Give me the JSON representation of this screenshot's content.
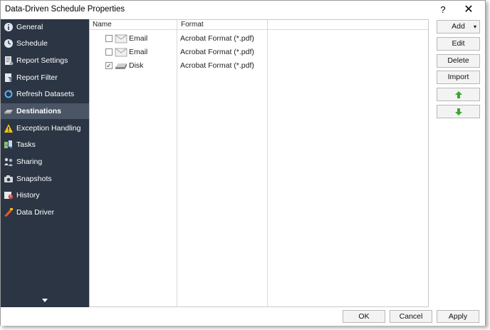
{
  "window": {
    "title": "Data-Driven Schedule Properties",
    "help_label": "?",
    "close_label": "✕"
  },
  "sidebar": {
    "items": [
      {
        "label": "General",
        "icon": "info-icon"
      },
      {
        "label": "Schedule",
        "icon": "clock-icon"
      },
      {
        "label": "Report Settings",
        "icon": "report-settings-icon"
      },
      {
        "label": "Report Filter",
        "icon": "filter-icon"
      },
      {
        "label": "Refresh Datasets",
        "icon": "refresh-icon"
      },
      {
        "label": "Destinations",
        "icon": "destinations-icon",
        "selected": true
      },
      {
        "label": "Exception Handling",
        "icon": "warning-icon"
      },
      {
        "label": "Tasks",
        "icon": "tasks-icon"
      },
      {
        "label": "Sharing",
        "icon": "sharing-icon"
      },
      {
        "label": "Snapshots",
        "icon": "snapshots-icon"
      },
      {
        "label": "History",
        "icon": "history-icon"
      },
      {
        "label": "Data Driver",
        "icon": "data-driver-icon"
      }
    ]
  },
  "list": {
    "columns": [
      "Name",
      "Format"
    ],
    "rows": [
      {
        "checked": false,
        "name": "Email",
        "format": "Acrobat Format (*.pdf)",
        "icon": "email-icon"
      },
      {
        "checked": false,
        "name": "Email",
        "format": "Acrobat Format (*.pdf)",
        "icon": "email-icon"
      },
      {
        "checked": true,
        "name": "Disk",
        "format": "Acrobat Format (*.pdf)",
        "icon": "disk-icon"
      }
    ]
  },
  "actions": {
    "add": "Add",
    "edit": "Edit",
    "delete": "Delete",
    "import": "Import"
  },
  "footer": {
    "ok": "OK",
    "cancel": "Cancel",
    "apply": "Apply"
  },
  "colors": {
    "sidebar_bg": "#2b3544",
    "sidebar_selected": "#4a5566",
    "up_arrow": "#3aa82e",
    "down_arrow": "#3aa82e"
  }
}
